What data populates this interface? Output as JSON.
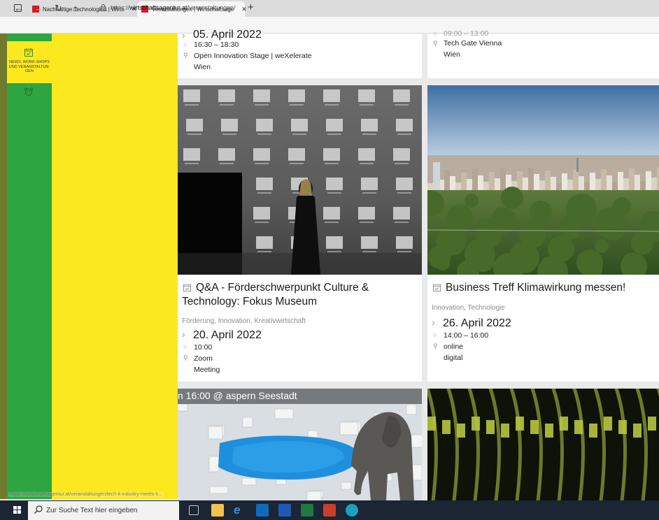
{
  "browser": {
    "tabs": [
      {
        "title": "Nachhaltige Technologien | Wirts"
      },
      {
        "title": "Veranstaltungen | Wirtschaftsage"
      }
    ],
    "url_prefix": "https://",
    "url_domain": "wirtschaftsagentur.at",
    "url_path": "/veranstaltungen/",
    "status_url": "https://wirtschaftsagentur.at/veranstaltungen/tech-it-industry-meets-fi..."
  },
  "sidebar": {
    "news_label": "NEWS, WORK-SHOPS UND VERANSTALTUN-GEN",
    "accent_green": "#2da541",
    "accent_yellow": "#fbe81f"
  },
  "events": {
    "partial_left": {
      "date": "05. April 2022",
      "time": "16:30 – 18:30",
      "location": "Open Innovation Stage | weXelerate",
      "city": "Wien"
    },
    "partial_right": {
      "time": "09:00 – 13:00",
      "location": "Tech Gate Vienna",
      "city": "Wien"
    },
    "card_a": {
      "title": "Q&A - Förderschwerpunkt Culture & Technology: Fokus Museum",
      "tags": [
        "Förderung",
        "Innovation",
        "Kreativwirtschaft"
      ],
      "date": "20. April 2022",
      "time": "10:00",
      "location": "Zoom",
      "sublocation": "Meeting"
    },
    "card_b": {
      "title": "Business Treff Klimawirkung messen!",
      "tags": [
        "Innovation",
        "Technologie"
      ],
      "date": "26. April 2022",
      "time": "14:00 – 16:00",
      "location": "online",
      "sublocation": "digital"
    },
    "card_c": {
      "banner": "n 16:00 @ aspern Seestadt"
    }
  },
  "taskbar": {
    "search_placeholder": "Zur Suche Text hier eingeben"
  }
}
